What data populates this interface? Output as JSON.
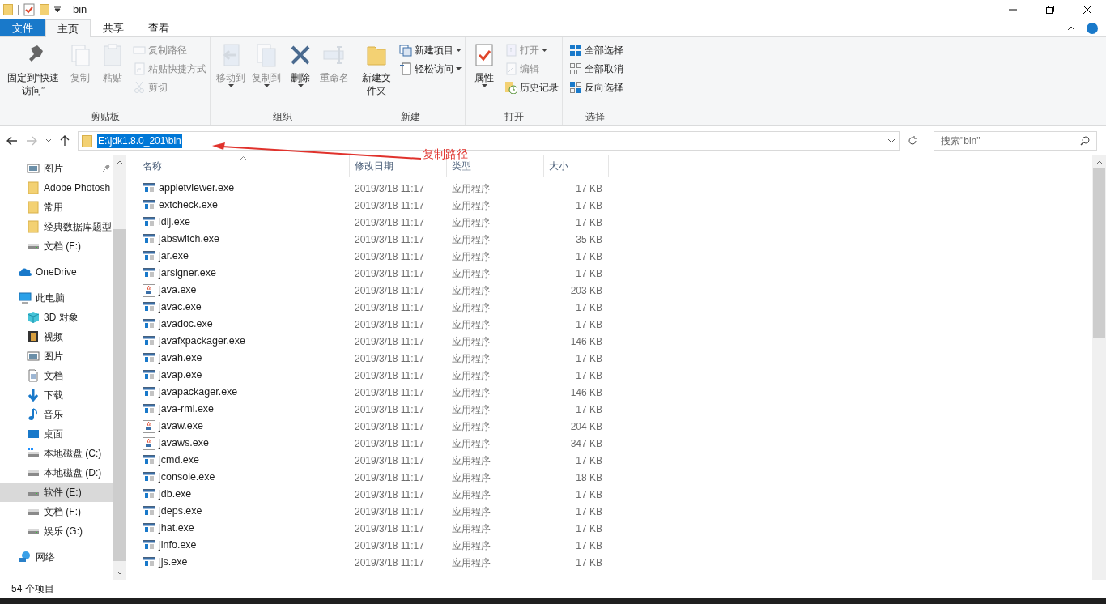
{
  "window": {
    "title": "bin"
  },
  "tabs": [
    {
      "label": "文件",
      "kind": "file",
      "selected": false
    },
    {
      "label": "主页",
      "kind": "tab",
      "selected": true
    },
    {
      "label": "共享",
      "kind": "tab",
      "selected": false
    },
    {
      "label": "查看",
      "kind": "tab",
      "selected": false
    }
  ],
  "ribbon": [
    {
      "label": "剪贴板",
      "large": [
        {
          "label": "固定到“快速访问”",
          "kind": "pin",
          "disabled": false,
          "dropdown": false
        },
        {
          "label": "复制",
          "kind": "copy",
          "disabled": true,
          "dropdown": false
        },
        {
          "label": "粘贴",
          "kind": "paste",
          "disabled": true,
          "dropdown": false
        }
      ],
      "small": [
        {
          "label": "复制路径",
          "kind": "path",
          "disabled": true,
          "dropdown": false
        },
        {
          "label": "粘贴快捷方式",
          "kind": "shortcut",
          "disabled": true,
          "dropdown": false
        },
        {
          "label": "剪切",
          "kind": "cut",
          "disabled": true,
          "dropdown": false
        }
      ]
    },
    {
      "label": "组织",
      "large": [
        {
          "label": "移动到",
          "kind": "move",
          "disabled": true,
          "dropdown": true
        },
        {
          "label": "复制到",
          "kind": "copyto",
          "disabled": true,
          "dropdown": true
        },
        {
          "label": "删除",
          "kind": "delete",
          "disabled": false,
          "dropdown": true
        },
        {
          "label": "重命名",
          "kind": "rename",
          "disabled": true,
          "dropdown": false
        }
      ]
    },
    {
      "label": "新建",
      "large": [
        {
          "label": "新建文件夹",
          "kind": "folder",
          "disabled": false,
          "dropdown": false
        }
      ],
      "small": [
        {
          "label": "新建项目",
          "kind": "newitem",
          "disabled": false,
          "dropdown": true
        },
        {
          "label": "轻松访问",
          "kind": "easy",
          "disabled": false,
          "dropdown": true
        }
      ]
    },
    {
      "label": "打开",
      "large": [
        {
          "label": "属性",
          "kind": "props",
          "disabled": false,
          "dropdown": true
        }
      ],
      "small": [
        {
          "label": "打开",
          "kind": "open",
          "disabled": true,
          "dropdown": true
        },
        {
          "label": "编辑",
          "kind": "edit",
          "disabled": true,
          "dropdown": false
        },
        {
          "label": "历史记录",
          "kind": "history",
          "disabled": false,
          "dropdown": false
        }
      ]
    },
    {
      "label": "选择",
      "small": [
        {
          "label": "全部选择",
          "kind": "selall",
          "disabled": false,
          "dropdown": false
        },
        {
          "label": "全部取消",
          "kind": "selnone",
          "disabled": false,
          "dropdown": false
        },
        {
          "label": "反向选择",
          "kind": "selinv",
          "disabled": false,
          "dropdown": false
        }
      ]
    }
  ],
  "address": {
    "path": "E:\\jdk1.8.0_201\\bin",
    "selected": true
  },
  "search": {
    "placeholder": "搜索\"bin\""
  },
  "annotation": {
    "text": "复制路径"
  },
  "sidebar": {
    "items": [
      {
        "label": "图片",
        "kind": "pictures",
        "pinned": true,
        "selected": false
      },
      {
        "label": "Adobe Photosh",
        "kind": "folder",
        "pinned": false,
        "selected": false
      },
      {
        "label": "常用",
        "kind": "folder",
        "pinned": false,
        "selected": false
      },
      {
        "label": "经典数据库题型",
        "kind": "folder",
        "pinned": false,
        "selected": false
      },
      {
        "label": "文档 (F:)",
        "kind": "drive",
        "pinned": false,
        "selected": false
      },
      {
        "label": "OneDrive",
        "kind": "cloud",
        "pinned": false,
        "selected": false,
        "top": true
      },
      {
        "label": "此电脑",
        "kind": "pc",
        "pinned": false,
        "selected": false,
        "top": true,
        "children": [
          {
            "label": "3D 对象",
            "kind": "cube",
            "pinned": false,
            "selected": false
          },
          {
            "label": "视频",
            "kind": "video",
            "pinned": false,
            "selected": false
          },
          {
            "label": "图片",
            "kind": "pictures",
            "pinned": false,
            "selected": false
          },
          {
            "label": "文档",
            "kind": "document",
            "pinned": false,
            "selected": false
          },
          {
            "label": "下载",
            "kind": "download",
            "pinned": false,
            "selected": false
          },
          {
            "label": "音乐",
            "kind": "music",
            "pinned": false,
            "selected": false
          },
          {
            "label": "桌面",
            "kind": "desktop",
            "pinned": false,
            "selected": false
          },
          {
            "label": "本地磁盘 (C:)",
            "kind": "windrive",
            "pinned": false,
            "selected": false
          },
          {
            "label": "本地磁盘 (D:)",
            "kind": "drive",
            "pinned": false,
            "selected": false
          },
          {
            "label": "软件 (E:)",
            "kind": "drive",
            "pinned": false,
            "selected": true
          },
          {
            "label": "文档 (F:)",
            "kind": "drive",
            "pinned": false,
            "selected": false
          },
          {
            "label": "娱乐 (G:)",
            "kind": "drive",
            "pinned": false,
            "selected": false
          }
        ]
      },
      {
        "label": "网络",
        "kind": "network",
        "pinned": false,
        "selected": false,
        "top": true
      }
    ]
  },
  "table": {
    "columns": [
      {
        "label": "名称",
        "sorted": true
      },
      {
        "label": "修改日期",
        "sorted": false
      },
      {
        "label": "类型",
        "sorted": false
      },
      {
        "label": "大小",
        "sorted": false
      }
    ],
    "rows": [
      {
        "name": "appletviewer.exe",
        "kind": "exe",
        "date": "2019/3/18 11:17",
        "type": "应用程序",
        "size": "17 KB"
      },
      {
        "name": "extcheck.exe",
        "kind": "exe",
        "date": "2019/3/18 11:17",
        "type": "应用程序",
        "size": "17 KB"
      },
      {
        "name": "idlj.exe",
        "kind": "exe",
        "date": "2019/3/18 11:17",
        "type": "应用程序",
        "size": "17 KB"
      },
      {
        "name": "jabswitch.exe",
        "kind": "exe",
        "date": "2019/3/18 11:17",
        "type": "应用程序",
        "size": "35 KB"
      },
      {
        "name": "jar.exe",
        "kind": "exe",
        "date": "2019/3/18 11:17",
        "type": "应用程序",
        "size": "17 KB"
      },
      {
        "name": "jarsigner.exe",
        "kind": "exe",
        "date": "2019/3/18 11:17",
        "type": "应用程序",
        "size": "17 KB"
      },
      {
        "name": "java.exe",
        "kind": "java",
        "date": "2019/3/18 11:17",
        "type": "应用程序",
        "size": "203 KB"
      },
      {
        "name": "javac.exe",
        "kind": "exe",
        "date": "2019/3/18 11:17",
        "type": "应用程序",
        "size": "17 KB"
      },
      {
        "name": "javadoc.exe",
        "kind": "exe",
        "date": "2019/3/18 11:17",
        "type": "应用程序",
        "size": "17 KB"
      },
      {
        "name": "javafxpackager.exe",
        "kind": "exe",
        "date": "2019/3/18 11:17",
        "type": "应用程序",
        "size": "146 KB"
      },
      {
        "name": "javah.exe",
        "kind": "exe",
        "date": "2019/3/18 11:17",
        "type": "应用程序",
        "size": "17 KB"
      },
      {
        "name": "javap.exe",
        "kind": "exe",
        "date": "2019/3/18 11:17",
        "type": "应用程序",
        "size": "17 KB"
      },
      {
        "name": "javapackager.exe",
        "kind": "exe",
        "date": "2019/3/18 11:17",
        "type": "应用程序",
        "size": "146 KB"
      },
      {
        "name": "java-rmi.exe",
        "kind": "exe",
        "date": "2019/3/18 11:17",
        "type": "应用程序",
        "size": "17 KB"
      },
      {
        "name": "javaw.exe",
        "kind": "java",
        "date": "2019/3/18 11:17",
        "type": "应用程序",
        "size": "204 KB"
      },
      {
        "name": "javaws.exe",
        "kind": "java",
        "date": "2019/3/18 11:17",
        "type": "应用程序",
        "size": "347 KB"
      },
      {
        "name": "jcmd.exe",
        "kind": "exe",
        "date": "2019/3/18 11:17",
        "type": "应用程序",
        "size": "17 KB"
      },
      {
        "name": "jconsole.exe",
        "kind": "exe",
        "date": "2019/3/18 11:17",
        "type": "应用程序",
        "size": "18 KB"
      },
      {
        "name": "jdb.exe",
        "kind": "exe",
        "date": "2019/3/18 11:17",
        "type": "应用程序",
        "size": "17 KB"
      },
      {
        "name": "jdeps.exe",
        "kind": "exe",
        "date": "2019/3/18 11:17",
        "type": "应用程序",
        "size": "17 KB"
      },
      {
        "name": "jhat.exe",
        "kind": "exe",
        "date": "2019/3/18 11:17",
        "type": "应用程序",
        "size": "17 KB"
      },
      {
        "name": "jinfo.exe",
        "kind": "exe",
        "date": "2019/3/18 11:17",
        "type": "应用程序",
        "size": "17 KB"
      },
      {
        "name": "jjs.exe",
        "kind": "exe",
        "date": "2019/3/18 11:17",
        "type": "应用程序",
        "size": "17 KB"
      }
    ]
  },
  "status_bar": {
    "count": "54 个项目"
  }
}
